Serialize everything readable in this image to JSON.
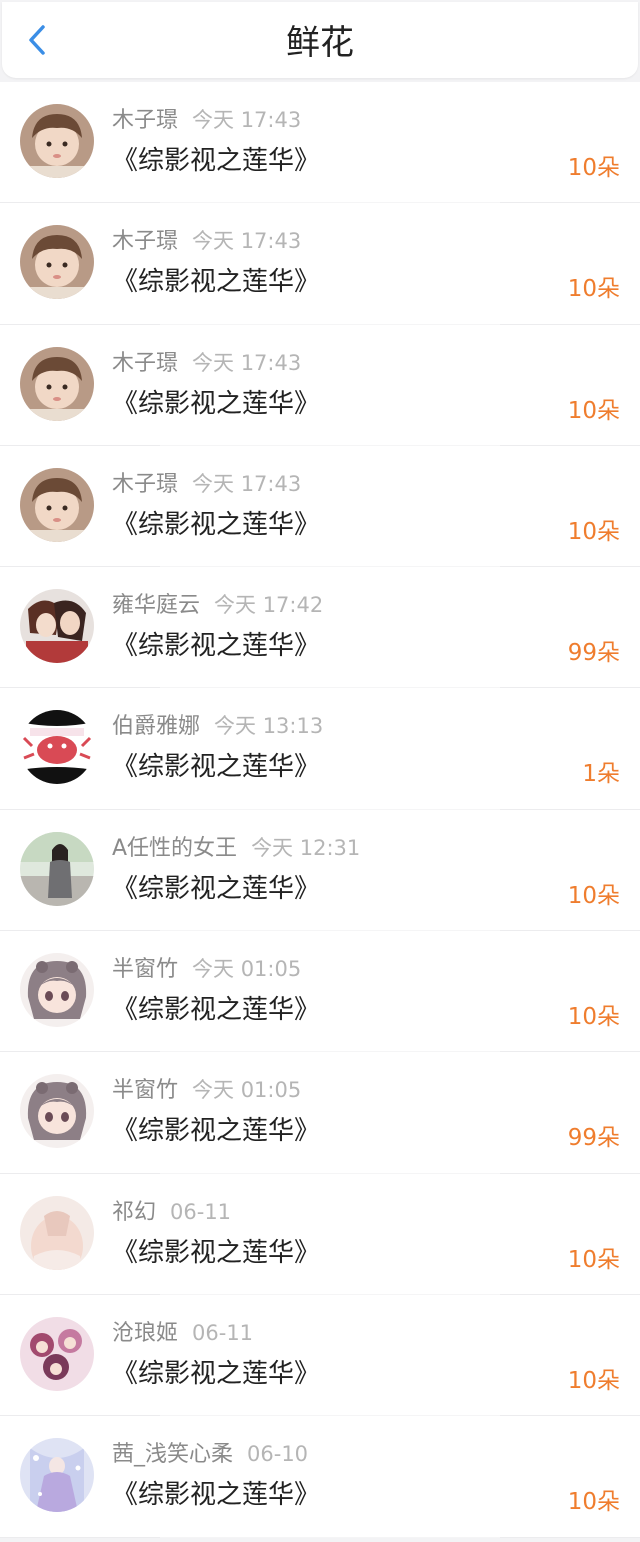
{
  "header": {
    "title": "鲜花",
    "back_icon": "chevron-left-icon",
    "accent_color": "#3b8ee6"
  },
  "colors": {
    "amount": "#ef7d2e",
    "name": "#8a8a8a",
    "time": "#b5b5b5"
  },
  "items": [
    {
      "name": "木子璟",
      "time": "今天 17:43",
      "book": "《综影视之莲华》",
      "amount": "10朵",
      "avatar": "boy"
    },
    {
      "name": "木子璟",
      "time": "今天 17:43",
      "book": "《综影视之莲华》",
      "amount": "10朵",
      "avatar": "boy"
    },
    {
      "name": "木子璟",
      "time": "今天 17:43",
      "book": "《综影视之莲华》",
      "amount": "10朵",
      "avatar": "boy"
    },
    {
      "name": "木子璟",
      "time": "今天 17:43",
      "book": "《综影视之莲华》",
      "amount": "10朵",
      "avatar": "boy"
    },
    {
      "name": "雍华庭云",
      "time": "今天 17:42",
      "book": "《综影视之莲华》",
      "amount": "99朵",
      "avatar": "anime-couple"
    },
    {
      "name": "伯爵雅娜",
      "time": "今天 13:13",
      "book": "《综影视之莲华》",
      "amount": "1朵",
      "avatar": "pink-crab"
    },
    {
      "name": "A任性的女王",
      "time": "今天 12:31",
      "book": "《综影视之莲华》",
      "amount": "10朵",
      "avatar": "woman-street"
    },
    {
      "name": "半窗竹",
      "time": "今天 01:05",
      "book": "《综影视之莲华》",
      "amount": "10朵",
      "avatar": "anime-girl"
    },
    {
      "name": "半窗竹",
      "time": "今天 01:05",
      "book": "《综影视之莲华》",
      "amount": "99朵",
      "avatar": "anime-girl"
    },
    {
      "name": "祁幻",
      "time": "06-11",
      "book": "《综影视之莲华》",
      "amount": "10朵",
      "avatar": "back-figure"
    },
    {
      "name": "沧琅姬",
      "time": "06-11",
      "book": "《综影视之莲华》",
      "amount": "10朵",
      "avatar": "anime-group"
    },
    {
      "name": "茜_浅笑心柔",
      "time": "06-10",
      "book": "《综影视之莲华》",
      "amount": "10朵",
      "avatar": "fairy"
    }
  ]
}
